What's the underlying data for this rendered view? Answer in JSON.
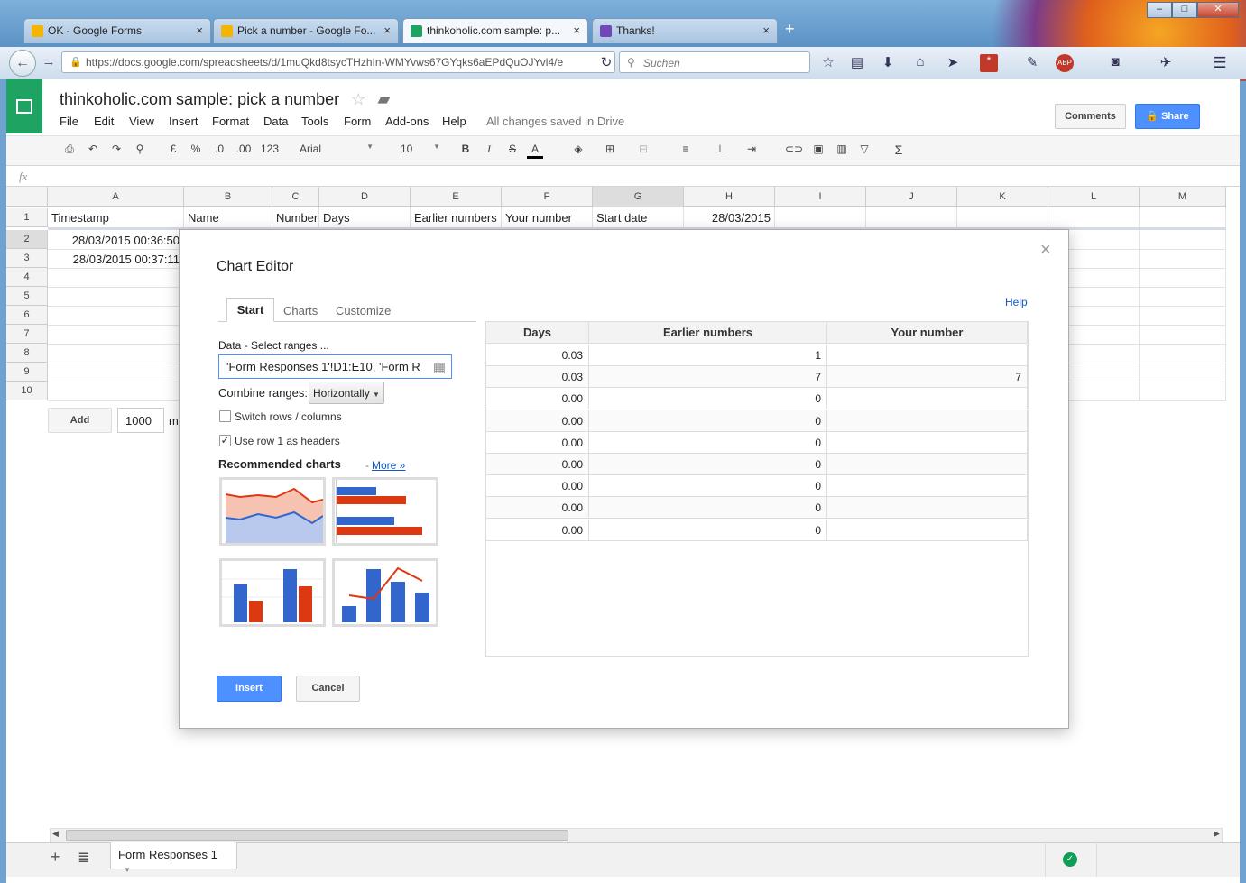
{
  "browser": {
    "tabs": [
      {
        "label": "OK - Google Forms",
        "icon": "drive-icon",
        "color": "#f4b400"
      },
      {
        "label": "Pick a number - Google Fo...",
        "icon": "drive-icon",
        "color": "#f4b400"
      },
      {
        "label": "thinkoholic.com sample: p...",
        "icon": "sheets-icon",
        "color": "#1ea362"
      },
      {
        "label": "Thanks!",
        "icon": "forms-icon",
        "color": "#7248b9"
      }
    ],
    "new_tab": "+",
    "url": "https://docs.google.com/spreadsheets/d/1muQkd8tsycTHzhIn-WMYvws67GYqks6aEPdQuOJYvl4/e",
    "search_placeholder": "Suchen"
  },
  "doc": {
    "title": "thinkoholic.com sample: pick a number",
    "menu": [
      "File",
      "Edit",
      "View",
      "Insert",
      "Format",
      "Data",
      "Tools",
      "Form",
      "Add-ons",
      "Help"
    ],
    "save_status": "All changes saved in Drive",
    "comments_label": "Comments",
    "share_label": "Share"
  },
  "toolbar": {
    "currency": "£",
    "percent": "%",
    "dec_less": ".0",
    "dec_more": ".00",
    "number_format": "123",
    "font": "Arial",
    "font_size": "10",
    "bold": "B",
    "italic": "I",
    "strike": "S",
    "text_color": "A",
    "sum": "Σ"
  },
  "formula_bar": {
    "fx": "fx"
  },
  "grid": {
    "columns": [
      "A",
      "B",
      "C",
      "D",
      "E",
      "F",
      "G",
      "H",
      "I",
      "J",
      "K",
      "L",
      "M"
    ],
    "rows": [
      "1",
      "2",
      "3",
      "4",
      "5",
      "6",
      "7",
      "8",
      "9",
      "10"
    ],
    "row1": [
      "Timestamp",
      "Name",
      "Number",
      "Days",
      "Earlier numbers",
      "Your number",
      "Start date",
      "28/03/2015"
    ],
    "row2_a": "28/03/2015 00:36:50",
    "row3_a": "28/03/2015 00:37:11",
    "add_label": "Add",
    "add_count": "1000",
    "add_suffix": "m"
  },
  "sheet_tabs": {
    "active": "Form Responses 1"
  },
  "chart_editor": {
    "title": "Chart Editor",
    "close": "×",
    "help": "Help",
    "tabs": [
      "Start",
      "Charts",
      "Customize"
    ],
    "data_label": "Data",
    "select_ranges": "- Select ranges ...",
    "range_value": "'Form Responses 1'!D1:E10, 'Form R",
    "combine_label": "Combine ranges:",
    "combine_value": "Horizontally",
    "switch_rows_label": "Switch rows / columns",
    "switch_rows_checked": false,
    "use_row1_label": "Use row 1 as headers",
    "use_row1_checked": true,
    "recommended_title": "Recommended charts",
    "more_sep": "-",
    "more_label": "More »",
    "preview": {
      "headers": [
        "Days",
        "Earlier numbers",
        "Your number"
      ],
      "rows": [
        [
          "0.03",
          "1",
          ""
        ],
        [
          "0.03",
          "7",
          "7"
        ],
        [
          "0.00",
          "0",
          ""
        ],
        [
          "0.00",
          "0",
          ""
        ],
        [
          "0.00",
          "0",
          ""
        ],
        [
          "0.00",
          "0",
          ""
        ],
        [
          "0.00",
          "0",
          ""
        ],
        [
          "0.00",
          "0",
          ""
        ],
        [
          "0.00",
          "0",
          ""
        ]
      ]
    },
    "insert_label": "Insert",
    "cancel_label": "Cancel"
  },
  "colors": {
    "accent_blue": "#4d90fe",
    "series_blue": "#3366cc",
    "series_red": "#dc3912",
    "sheets_green": "#1ea362"
  }
}
